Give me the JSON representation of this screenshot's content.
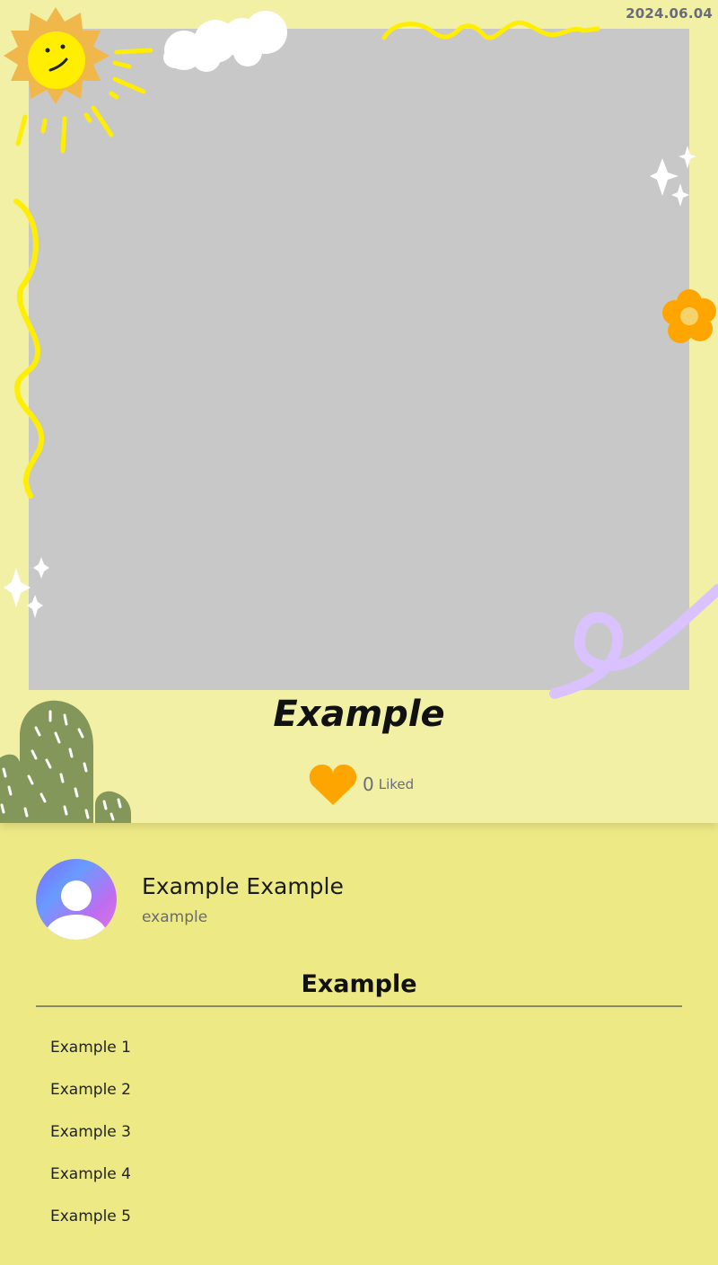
{
  "card": {
    "date": "2024.06.04",
    "title": "Example",
    "like_count": "0",
    "like_label": "Liked"
  },
  "icons": {
    "heart": "heart-icon",
    "avatar": "user-avatar-icon",
    "decorations": [
      "sun-icon",
      "cloud-icon",
      "sparkle-icon",
      "flower-icon",
      "cactus-icon",
      "squiggle-line",
      "ribbon-curl"
    ]
  },
  "colors": {
    "card_bg": "#f2f0a5",
    "page_bg": "#ede985",
    "photo_placeholder": "#c8c8c8",
    "heart": "#ffa500",
    "sun": "#f0b84a",
    "squiggle": "#ffee00",
    "cactus": "#84975a",
    "ribbon": "#d9c2ff",
    "flower": "#ffa500"
  },
  "profile": {
    "name": "Example Example",
    "handle": "example"
  },
  "section": {
    "title": "Example",
    "items": [
      "Example 1",
      "Example 2",
      "Example 3",
      "Example 4",
      "Example 5"
    ]
  }
}
